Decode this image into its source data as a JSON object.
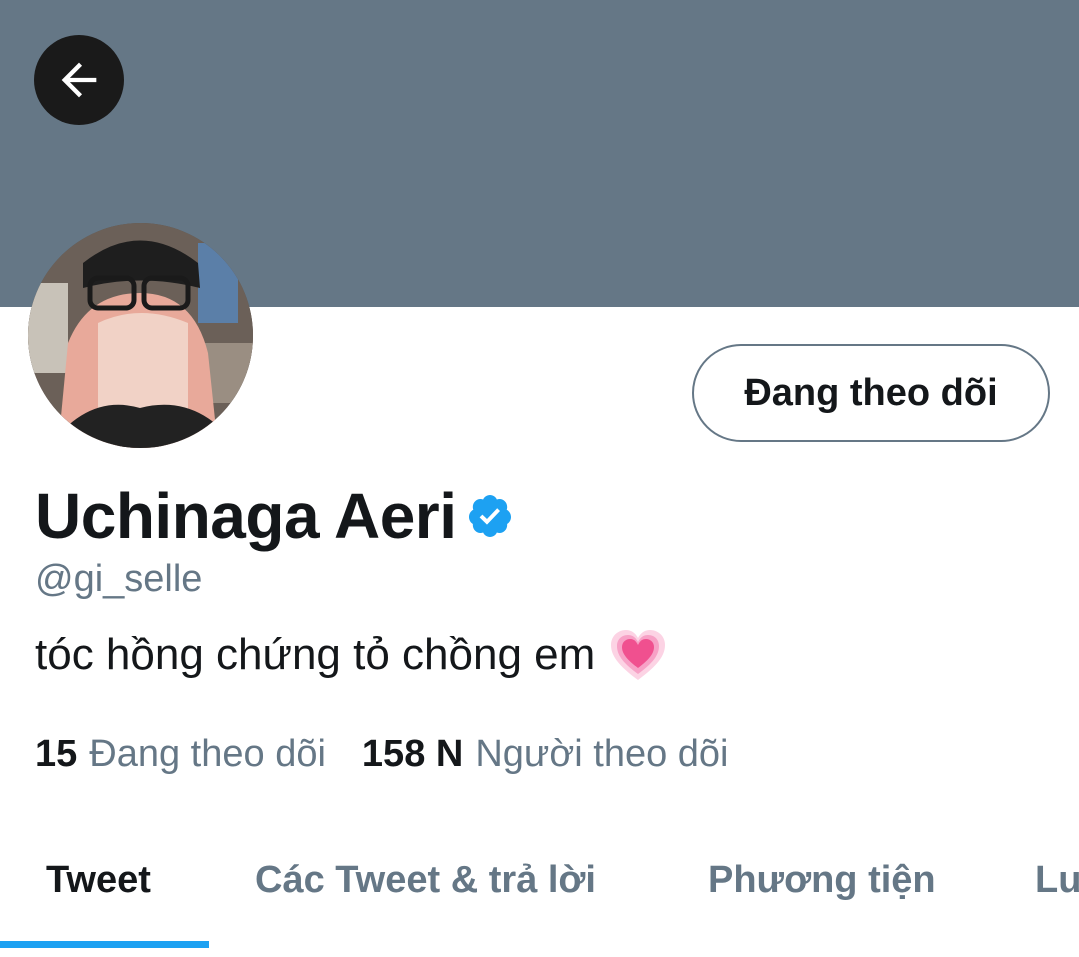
{
  "header": {
    "back_icon": "arrow-left-icon",
    "banner_color": "#657786"
  },
  "profile": {
    "display_name": "Uchinaga Aeri",
    "verified_icon": "verified-badge-icon",
    "verified_color": "#1da1f2",
    "handle": "@gi_selle",
    "bio": "tóc hồng chứng tỏ chồng em",
    "bio_emoji": "growing-heart-emoji",
    "follow_button_label": "Đang theo dõi"
  },
  "stats": {
    "following_count": "15",
    "following_label": "Đang theo dõi",
    "followers_count": "158 N",
    "followers_label": "Người theo dõi"
  },
  "tabs": [
    {
      "label": "Tweet",
      "active": true
    },
    {
      "label": "Các Tweet & trả lời",
      "active": false
    },
    {
      "label": "Phương tiện",
      "active": false
    },
    {
      "label": "Lu",
      "active": false
    }
  ],
  "colors": {
    "accent": "#1da1f2",
    "secondary_text": "#657786",
    "primary_text": "#14171a"
  }
}
